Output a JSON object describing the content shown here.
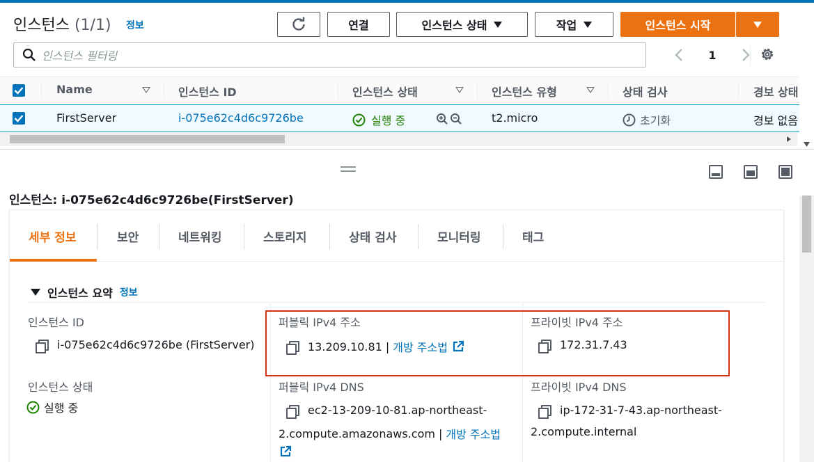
{
  "header": {
    "title": "인스턴스",
    "count": "(1/1)",
    "info": "정보",
    "connect_label": "연결",
    "instance_state_label": "인스턴스 상태",
    "actions_label": "작업",
    "launch_label": "인스턴스 시작",
    "search_placeholder": "인스턴스 필터링",
    "page": "1"
  },
  "table": {
    "columns": [
      "Name",
      "인스턴스 ID",
      "인스턴스 상태",
      "인스턴스 유형",
      "상태 검사",
      "경보 상태"
    ],
    "row": {
      "name": "FirstServer",
      "instance_id": "i-075e62c4d6c9726be",
      "state": "실행 중",
      "type": "t2.micro",
      "status_check": "초기화",
      "alarm": "경보 없음"
    }
  },
  "detail": {
    "title": "인스턴스: i-075e62c4d6c9726be(FirstServer)",
    "tabs": [
      "세부 정보",
      "보안",
      "네트워킹",
      "스토리지",
      "상태 검사",
      "모니터링",
      "태그"
    ],
    "active_tab": "세부 정보",
    "section_title": "인스턴스 요약",
    "section_info": "정보",
    "instance_id_label": "인스턴스 ID",
    "instance_id_value": "i-075e62c4d6c9726be (FirstServer)",
    "public_ipv4_label": "퍼블릭 IPv4 주소",
    "public_ipv4_value": "13.209.10.81",
    "open_address_label": "개방 주소법",
    "private_ipv4_label": "프라이빗 IPv4 주소",
    "private_ipv4_value": "172.31.7.43",
    "instance_state_label": "인스턴스 상태",
    "instance_state_value": "실행 중",
    "public_dns_label": "퍼블릭 IPv4 DNS",
    "public_dns_line1": "ec2-13-209-10-81.ap-northeast-",
    "public_dns_line2": "2.compute.amazonaws.com",
    "private_dns_label": "프라이빗 IPv4 DNS",
    "private_dns_line1": "ip-172-31-7-43.ap-northeast-",
    "private_dns_line2": "2.compute.internal"
  },
  "colors": {
    "accent_orange": "#ec7211",
    "link_blue": "#0073bb",
    "success_green": "#1d8102",
    "highlight_red": "#d13212"
  }
}
